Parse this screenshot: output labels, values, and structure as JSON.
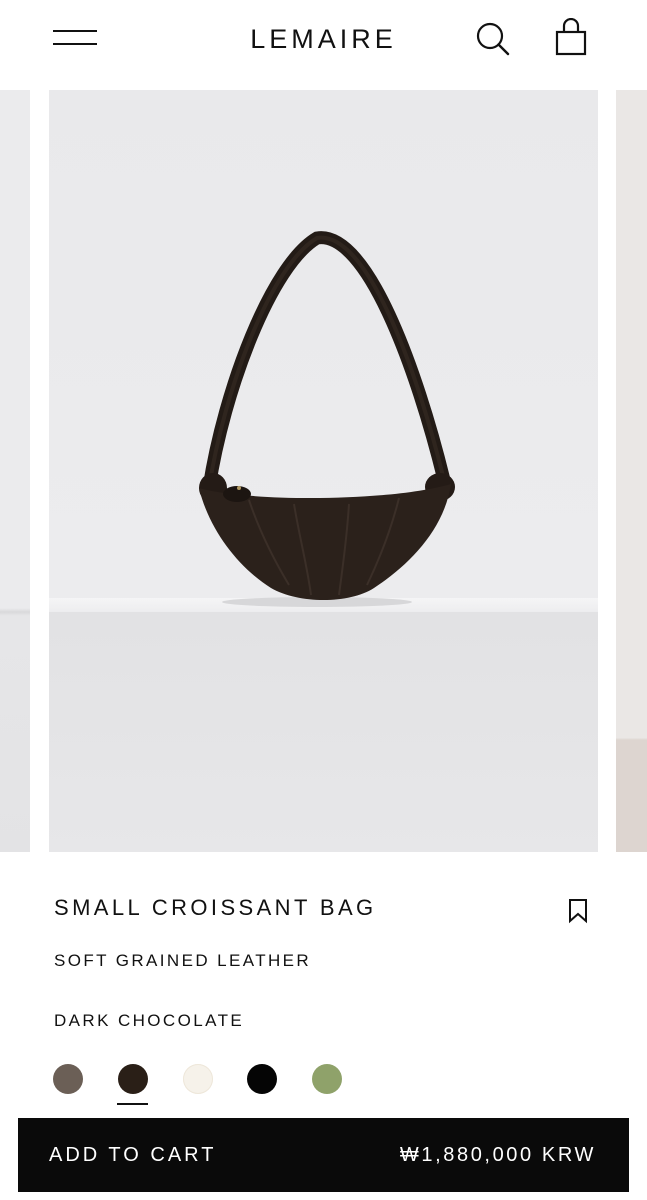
{
  "header": {
    "logo": "LEMAIRE"
  },
  "icons": {
    "menu": "hamburger-menu-icon",
    "search": "search-icon",
    "bag": "shopping-bag-icon",
    "wishlist": "bookmark-icon"
  },
  "product": {
    "title": "SMALL CROISSANT BAG",
    "material": "SOFT GRAINED LEATHER",
    "color": "DARK CHOCOLATE",
    "swatches": [
      {
        "color": "#6b5f56",
        "selected": false
      },
      {
        "color": "#2a1f17",
        "selected": true
      },
      {
        "color": "#f6f2ea",
        "selected": false
      },
      {
        "color": "#050505",
        "selected": false
      },
      {
        "color": "#8fa26a",
        "selected": false
      }
    ]
  },
  "cart": {
    "label": "ADD TO CART",
    "price": "₩1,880,000 KRW"
  }
}
